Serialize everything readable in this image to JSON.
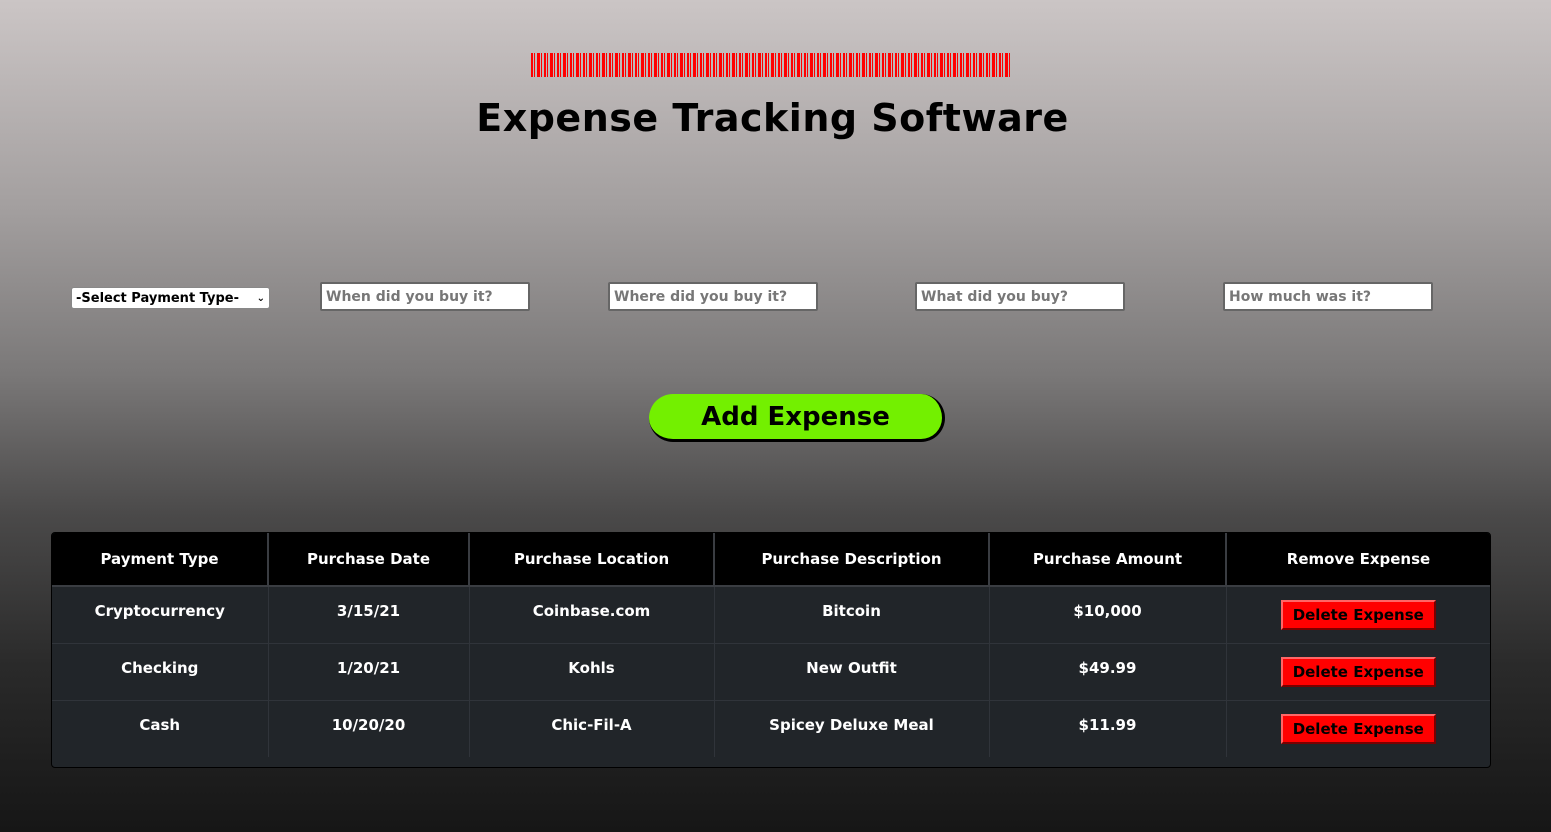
{
  "header": {
    "title": "Expense Tracking Software",
    "banner_color": "#ff0000"
  },
  "form": {
    "payment_select": {
      "selected": "-Select Payment Type-"
    },
    "date_placeholder": "When did you buy it?",
    "location_placeholder": "Where did you buy it?",
    "description_placeholder": "What did you buy?",
    "amount_placeholder": "How much was it?",
    "add_button_label": "Add Expense",
    "add_button_color": "#73f000"
  },
  "table": {
    "headers": [
      "Payment Type",
      "Purchase Date",
      "Purchase Location",
      "Purchase Description",
      "Purchase Amount",
      "Remove Expense"
    ],
    "rows": [
      {
        "type": "Cryptocurrency",
        "date": "3/15/21",
        "location": "Coinbase.com",
        "description": "Bitcoin",
        "amount": "$10,000",
        "action": "Delete Expense"
      },
      {
        "type": "Checking",
        "date": "1/20/21",
        "location": "Kohls",
        "description": "New Outfit",
        "amount": "$49.99",
        "action": "Delete Expense"
      },
      {
        "type": "Cash",
        "date": "10/20/20",
        "location": "Chic-Fil-A",
        "description": "Spicey Deluxe Meal",
        "amount": "$11.99",
        "action": "Delete Expense"
      }
    ],
    "delete_color": "#ff0000"
  }
}
